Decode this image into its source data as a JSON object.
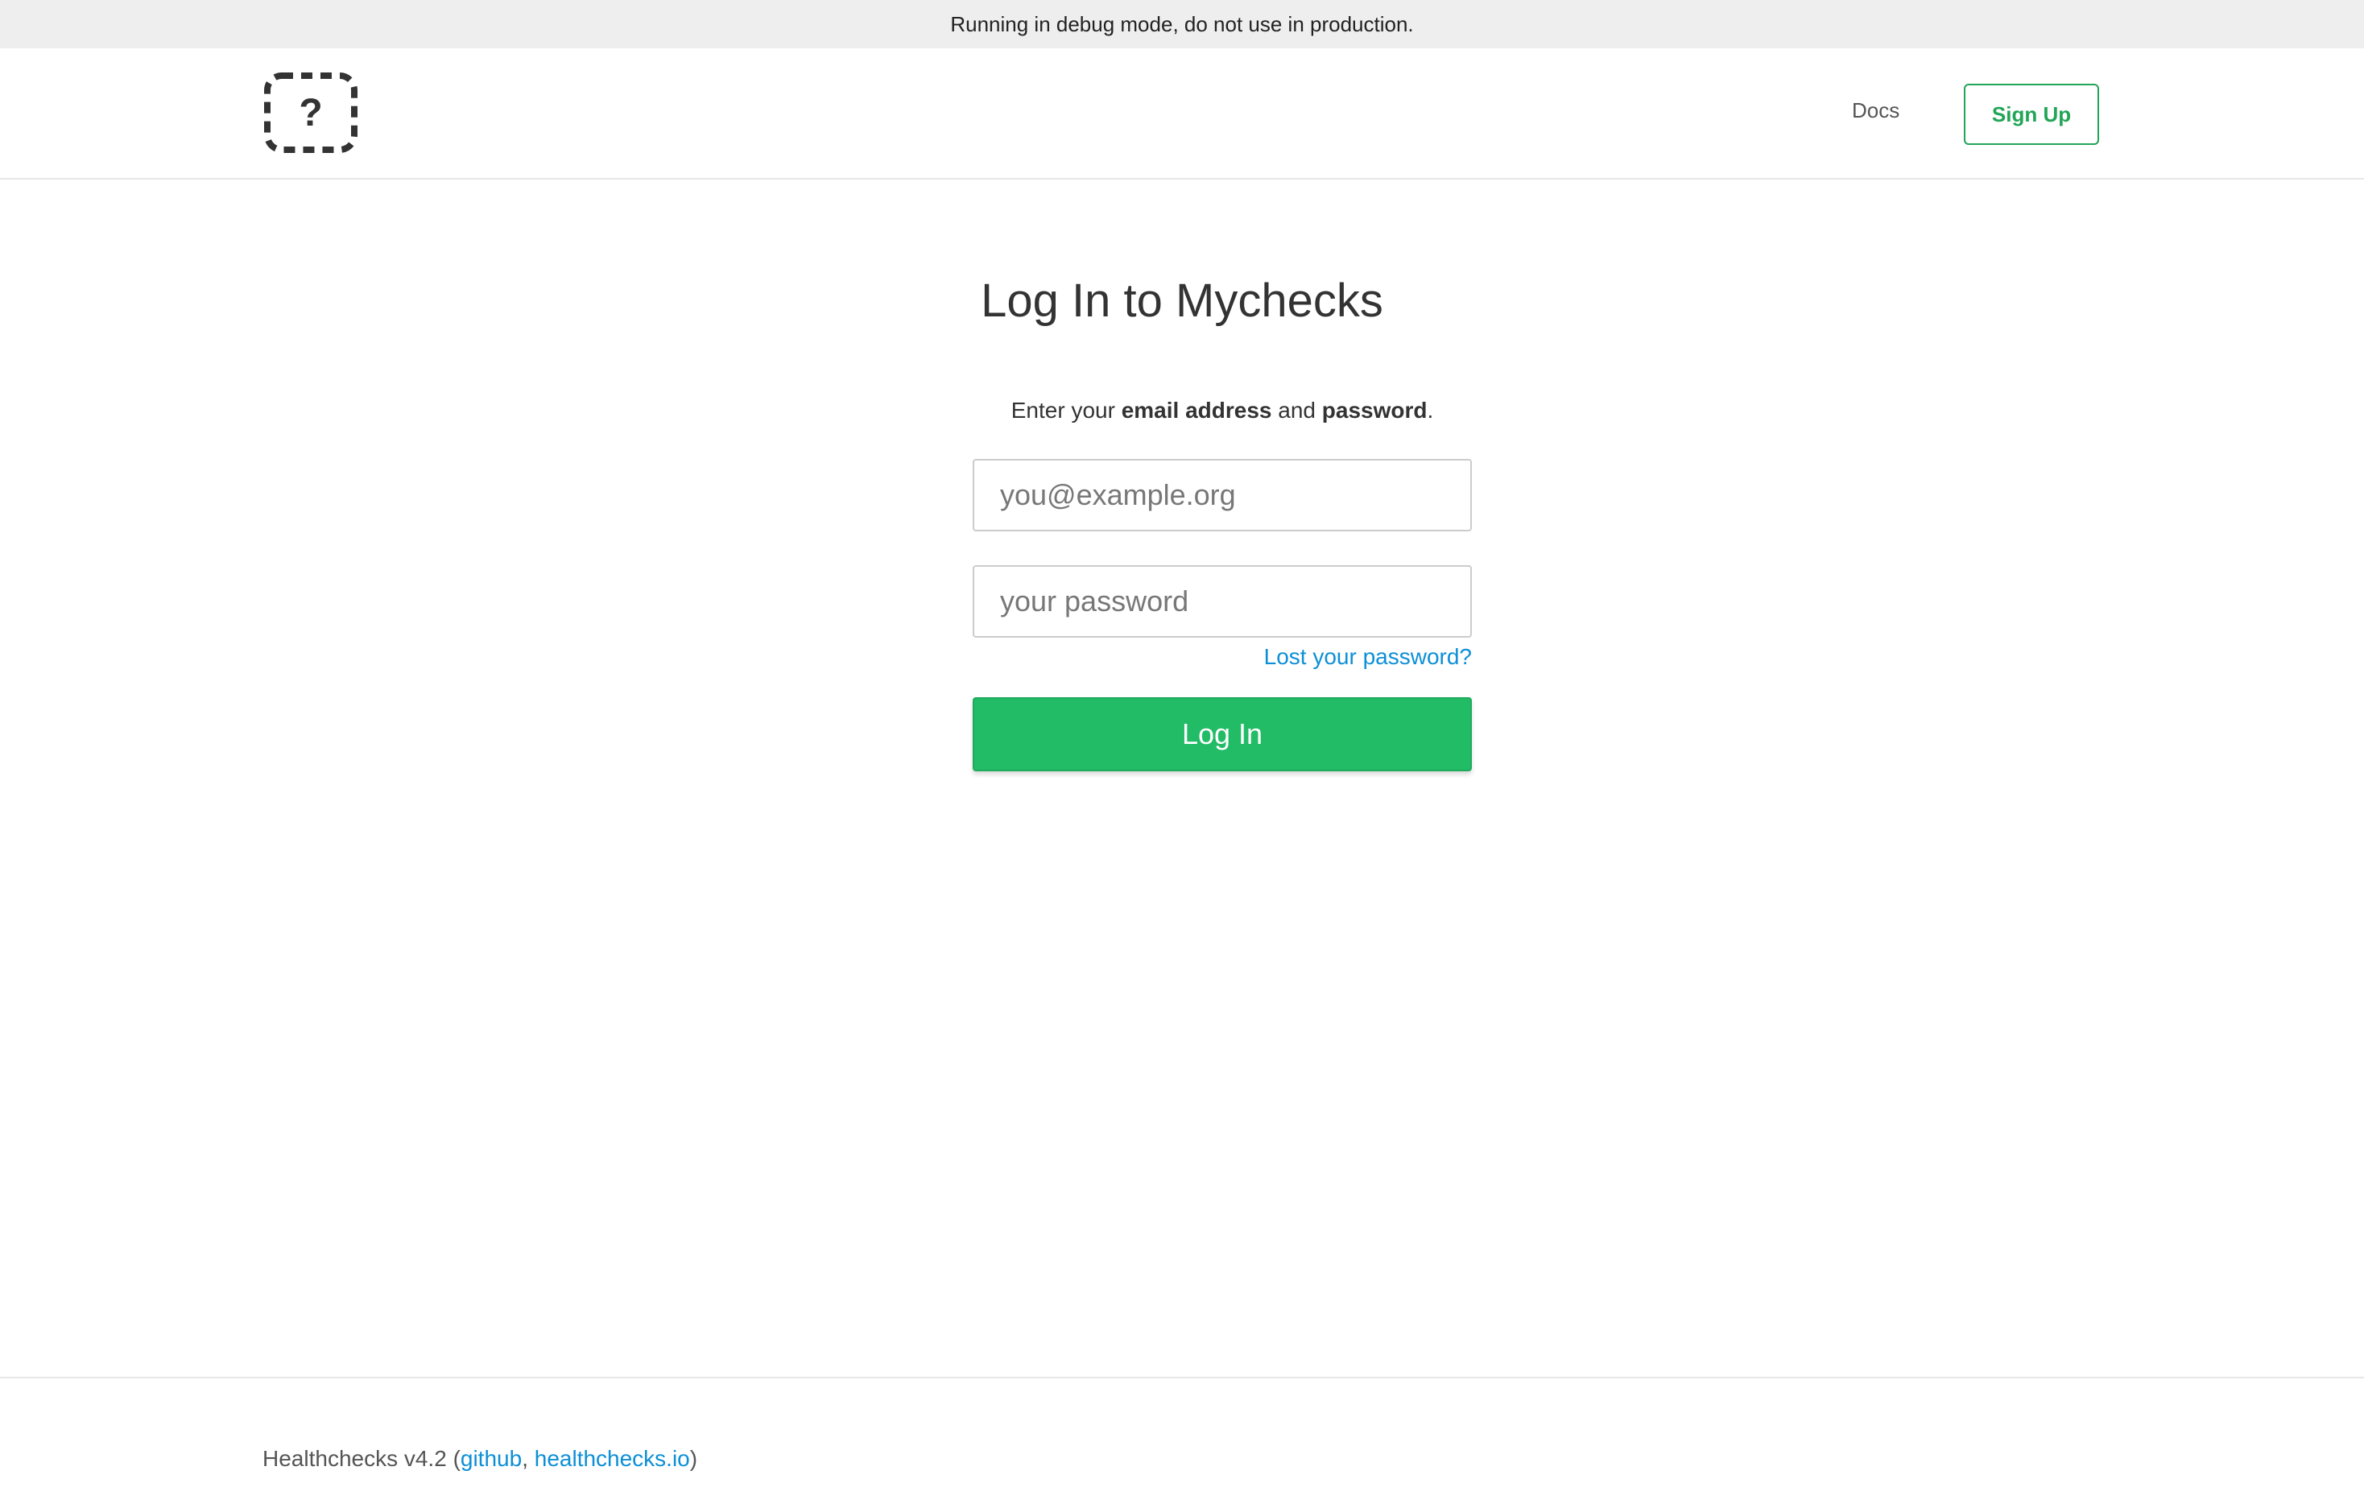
{
  "debug_bar": {
    "text": "Running in debug mode, do not use in production."
  },
  "header": {
    "logo_icon": "dashed-question-icon",
    "nav": {
      "docs_label": "Docs",
      "signup_label": "Sign Up"
    }
  },
  "login": {
    "title": "Log In to Mychecks",
    "instructions": {
      "prefix": "Enter your ",
      "email_bold": "email address",
      "middle": " and ",
      "password_bold": "password",
      "suffix": "."
    },
    "email_field": {
      "placeholder": "you@example.org",
      "value": ""
    },
    "password_field": {
      "placeholder": "your password",
      "value": ""
    },
    "lost_password_label": "Lost your password?",
    "submit_label": "Log In"
  },
  "footer": {
    "prefix": "Healthchecks v4.2 (",
    "link_github": "github",
    "separator": ", ",
    "link_site": "healthchecks.io",
    "suffix": ")"
  },
  "colors": {
    "accent_green": "#22bb66",
    "signup_green": "#22a556",
    "link_blue": "#0c8fd6"
  }
}
